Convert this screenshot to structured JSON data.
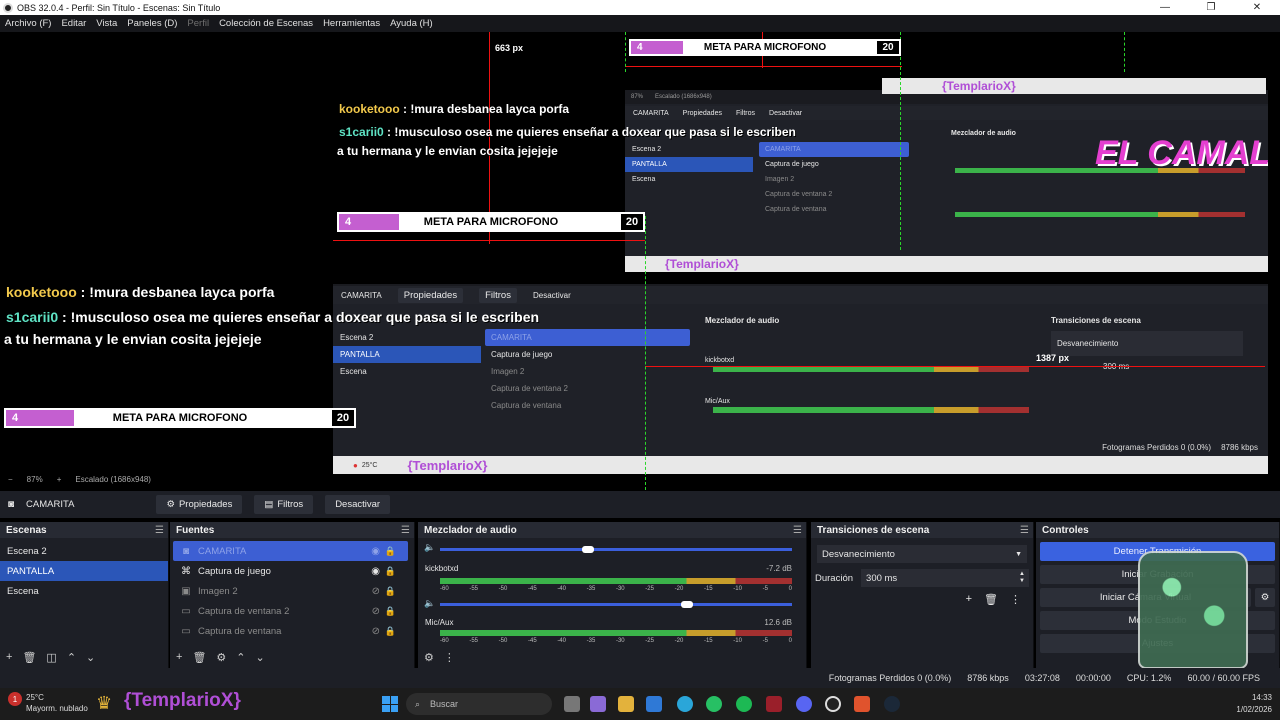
{
  "window": {
    "title": "OBS 32.0.4 - Perfil: Sin Título - Escenas: Sin Título",
    "controls": [
      "—",
      "❐",
      "✕"
    ]
  },
  "menu": {
    "items": [
      "Archivo (F)",
      "Editar",
      "Vista",
      "Paneles (D)",
      "Perfil",
      "Colección de Escenas",
      "Herramientas",
      "Ayuda (H)"
    ]
  },
  "preview": {
    "chat": [
      {
        "user": "kooketooo",
        "message": " : !mura desbanea layca porfa"
      },
      {
        "user": "s1carii0",
        "message": " : !musculoso osea me quieres enseñar a doxear que pasa si le escriben"
      },
      {
        "user": "",
        "message": "a tu hermana y le envian cosita jejejeje"
      }
    ],
    "meta": {
      "left": "4",
      "label": "META PARA MICROFONO",
      "right": "20"
    },
    "px_label": "663 px",
    "px_label2": "1387 px",
    "templario": "{TemplarioX}",
    "camal": "EL CAMAL",
    "zoom": "87%",
    "scale": "Escalado (1686x948)"
  },
  "toolbar": {
    "source_name": "CAMARITA",
    "properties": "Propiedades",
    "filters": "Filtros",
    "deactivate": "Desactivar"
  },
  "scenes": {
    "title": "Escenas",
    "items": [
      "Escena 2",
      "PANTALLA",
      "Escena"
    ],
    "active_index": 1
  },
  "sources": {
    "title": "Fuentes",
    "items": [
      {
        "name": "CAMARITA",
        "visible": true,
        "active": true
      },
      {
        "name": "Captura de juego",
        "visible": true,
        "active": false
      },
      {
        "name": "Imagen 2",
        "visible": false,
        "active": false
      },
      {
        "name": "Captura de ventana 2",
        "visible": false,
        "active": false
      },
      {
        "name": "Captura de ventana",
        "visible": false,
        "active": false
      }
    ]
  },
  "mixer": {
    "title": "Mezclador de audio",
    "ticks": [
      "-60",
      "-55",
      "-50",
      "-45",
      "-40",
      "-35",
      "-30",
      "-25",
      "-20",
      "-15",
      "-10",
      "-5",
      "0"
    ],
    "channels": [
      {
        "name": "kickbotxd",
        "db": "-7.2 dB",
        "volume": 0.42
      },
      {
        "name": "Mic/Aux",
        "db": "12.6 dB",
        "volume": 0.7
      }
    ]
  },
  "transitions": {
    "title": "Transiciones de escena",
    "selected": "Desvanecimiento",
    "duration_label": "Duración",
    "duration_value": "300 ms"
  },
  "controls": {
    "title": "Controles",
    "buttons": [
      "Detener Transmisión",
      "Iniciar Grabación",
      "Iniciar Cámara Virtual",
      "Modo Estudio",
      "Ajustes"
    ]
  },
  "status": {
    "dropped": "Fotogramas Perdidos 0 (0.0%)",
    "bitrate": "8786 kbps",
    "stream_time": "03:27:08",
    "rec_time": "00:00:00",
    "cpu": "CPU: 1.2%",
    "fps": "60.00 / 60.00 FPS"
  },
  "taskbar": {
    "weather_temp": "25°C",
    "weather_desc": "Mayorm. nublado",
    "search_placeholder": "Buscar",
    "time": "14:33",
    "date": "1/02/2026"
  },
  "colors": {
    "accent": "#3a62e0",
    "meter_green": "#3bb34a",
    "meter_yellow": "#c79d2b",
    "meter_red": "#a33030",
    "meta_fill": "#c45fd0",
    "guide_red": "#e11111",
    "guide_green": "#2bd62b"
  }
}
